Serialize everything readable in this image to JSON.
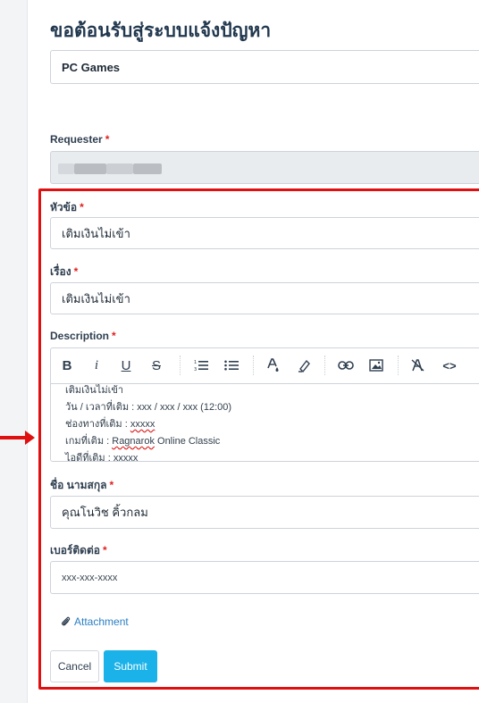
{
  "page": {
    "title": "ขอต้อนรับสู่ระบบแจ้งปัญหา",
    "category_value": "PC Games"
  },
  "requester": {
    "label": "Requester",
    "required_mark": "*"
  },
  "form": {
    "subject": {
      "label": "หัวข้อ",
      "required_mark": "*",
      "value": "เติมเงินไม่เข้า"
    },
    "topic": {
      "label": "เรื่อง",
      "required_mark": "*",
      "value": "เติมเงินไม่เข้า"
    },
    "description": {
      "label": "Description",
      "required_mark": "*",
      "toolbar": {
        "bold": "B",
        "italic": "i",
        "underline": "U",
        "strikethrough": "S",
        "code": "<>"
      },
      "lines": [
        "เติมเงินไม่เข้า",
        "วัน / เวลาที่เติม : xxx / xxx / xxx (12:00)",
        "ช่องทางที่เติม : ",
        "xxxxx",
        "เกมที่เติม : ",
        "Ragnarok",
        " Online Classic",
        "ไอดีที่เติม : xxxxx"
      ]
    },
    "fullname": {
      "label": "ชื่อ นามสกุล",
      "required_mark": "*",
      "value": "คุณโนวิช คิ้วกลม"
    },
    "phone": {
      "label": "เบอร์ติดต่อ",
      "required_mark": "*",
      "value": "xxx-xxx-xxxx"
    },
    "attachment_label": "Attachment",
    "cancel_label": "Cancel",
    "submit_label": "Submit"
  },
  "colors": {
    "highlight_frame": "#e01010",
    "submit_bg": "#1ab2e8",
    "link": "#2a7fc4"
  },
  "icons": [
    "bold-icon",
    "italic-icon",
    "underline-icon",
    "strikethrough-icon",
    "numbered-list-icon",
    "bullet-list-icon",
    "text-color-icon",
    "highlight-icon",
    "link-icon",
    "image-icon",
    "clear-format-icon",
    "code-icon",
    "paperclip-icon"
  ]
}
